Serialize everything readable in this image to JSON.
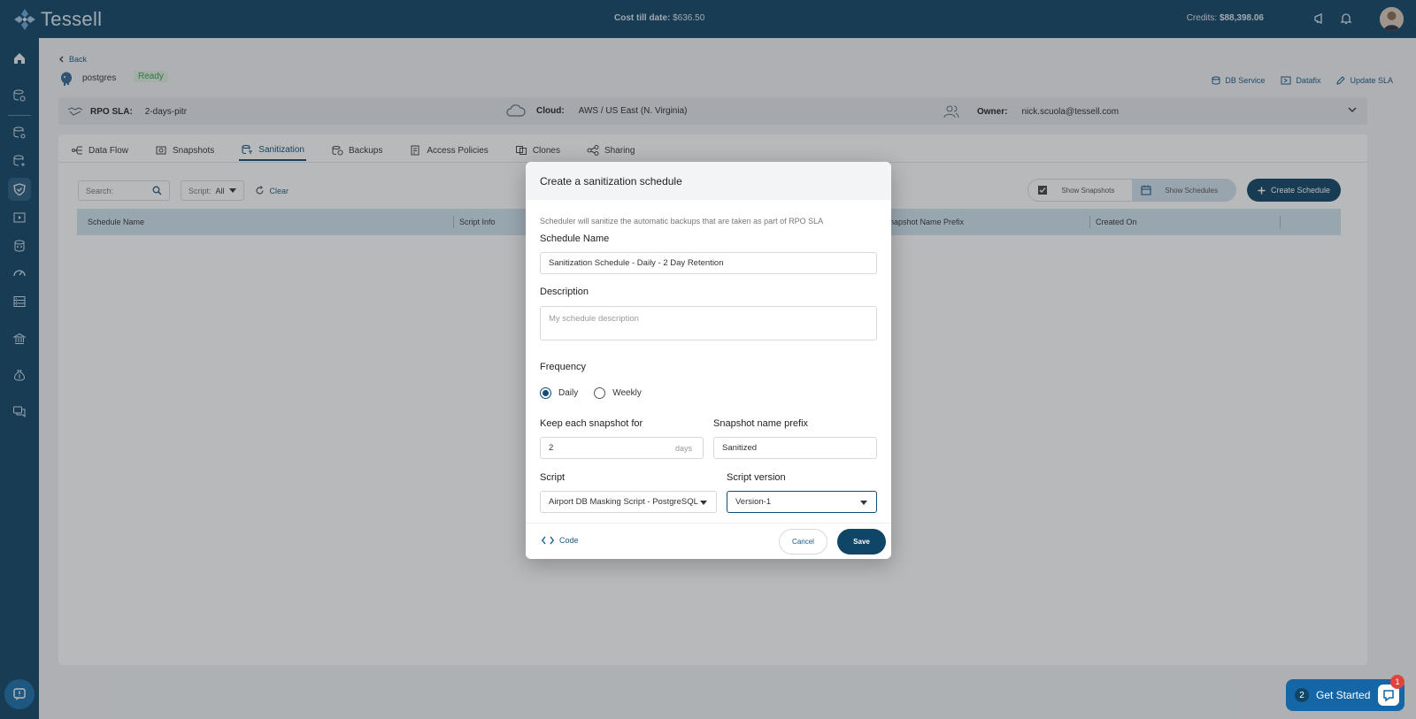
{
  "app": {
    "name": "Tessell",
    "cost_label": "Cost till date:",
    "cost_value": "$636.50",
    "credits_label": "Credits:",
    "credits_value": "$88,398.06"
  },
  "service": {
    "back_label": "Back",
    "name": "postgres",
    "status": "Ready",
    "actions": [
      "DB Service",
      "Datafix",
      "Update SLA"
    ]
  },
  "info": {
    "rpo_label": "RPO SLA:",
    "rpo_value": "2-days-pitr",
    "cloud_label": "Cloud:",
    "cloud_value": "AWS / US East (N. Virginia)",
    "owner_label": "Owner:",
    "owner_value": "nick.scuola@tessell.com"
  },
  "tabs": [
    {
      "label": "Data Flow",
      "icon": "flow-icon"
    },
    {
      "label": "Snapshots",
      "icon": "camera-icon"
    },
    {
      "label": "Sanitization",
      "icon": "sanitize-icon"
    },
    {
      "label": "Backups",
      "icon": "backup-icon"
    },
    {
      "label": "Access Policies",
      "icon": "policy-icon"
    },
    {
      "label": "Clones",
      "icon": "clone-icon"
    },
    {
      "label": "Sharing",
      "icon": "share-icon"
    }
  ],
  "active_tab": "Sanitization",
  "filters": {
    "search_placeholder": "Search:",
    "script_label": "Script:",
    "script_value": "All",
    "clear_label": "Clear"
  },
  "view_toggle": {
    "show_snapshots": "Show Snapshots",
    "show_schedules": "Show Schedules",
    "create_schedule": "Create Schedule"
  },
  "table": {
    "columns": [
      "Schedule Name",
      "Script Info",
      "Snapshot Name Prefix",
      "Created On"
    ]
  },
  "modal": {
    "title": "Create a sanitization schedule",
    "hint": "Scheduler will sanitize the automatic backups that are taken as part of RPO SLA",
    "schedule_name_label": "Schedule Name",
    "schedule_name_value": "Sanitization Schedule - Daily - 2 Day Retention",
    "description_label": "Description",
    "description_placeholder": "My schedule description",
    "frequency_label": "Frequency",
    "frequency_options": [
      "Daily",
      "Weekly"
    ],
    "frequency_selected": "Daily",
    "keep_label": "Keep each snapshot for",
    "keep_value": "2",
    "keep_unit": "days",
    "prefix_label": "Snapshot name prefix",
    "prefix_value": "Sanitized",
    "script_label": "Script",
    "script_value": "Airport DB Masking Script - PostgreSQL",
    "script_version_label": "Script version",
    "script_version_value": "Version-1",
    "code_label": "Code",
    "cancel_label": "Cancel",
    "save_label": "Save"
  },
  "get_started": {
    "count": "2",
    "label": "Get Started",
    "badge": "1"
  },
  "colors": {
    "brand": "#0f4566",
    "accent": "#124d74",
    "status_ready": "#3a9a4c"
  }
}
